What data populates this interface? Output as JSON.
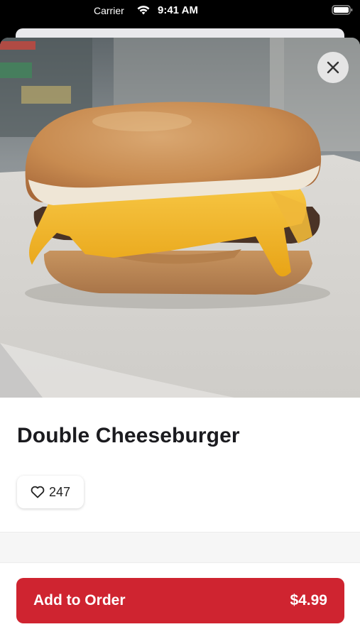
{
  "status_bar": {
    "carrier": "Carrier",
    "time": "9:41 AM"
  },
  "hero": {
    "image_icon": "burger-photo",
    "close_icon": "close-icon"
  },
  "item": {
    "title": "Double Cheeseburger",
    "likes_icon": "heart-outline-icon",
    "likes_count": "247"
  },
  "cta": {
    "label": "Add to Order",
    "price": "$4.99"
  },
  "colors": {
    "accent": "#cf2430",
    "text": "#1b1b1f",
    "background": "#ffffff"
  }
}
